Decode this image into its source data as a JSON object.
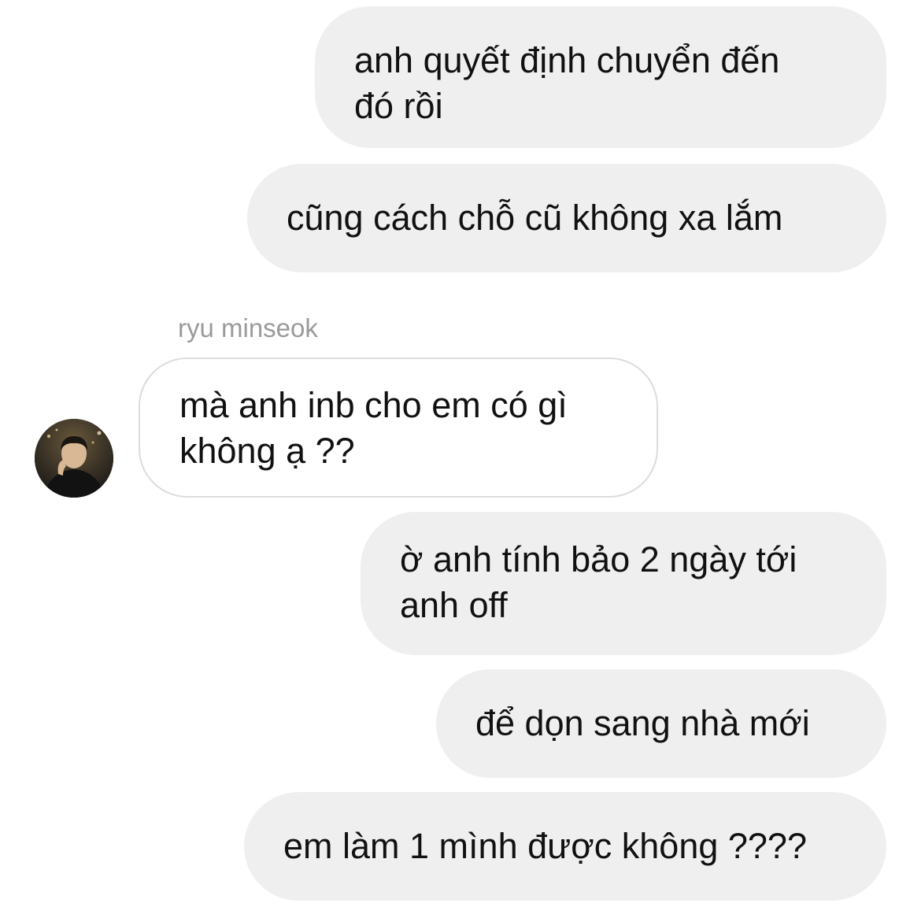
{
  "conversation": {
    "messages": [
      {
        "direction": "outgoing",
        "text": "anh quyết định chuyển đến\nđó rồi"
      },
      {
        "direction": "outgoing",
        "text": "cũng cách chỗ cũ không xa lắm"
      },
      {
        "direction": "incoming",
        "sender": "ryu minseok",
        "text": "mà anh inb cho em có gì\nkhông ạ ??"
      },
      {
        "direction": "outgoing",
        "text": "ờ anh tính bảo 2 ngày tới\nanh off"
      },
      {
        "direction": "outgoing",
        "text": "để dọn sang nhà mới"
      },
      {
        "direction": "outgoing",
        "text": "em làm 1 mình được không ????"
      }
    ]
  },
  "colors": {
    "outgoing_bubble": "#efefef",
    "incoming_bubble_border": "#dcdcdc",
    "sender_name": "#9a9a9a",
    "text": "#111111"
  },
  "icons": {
    "avatar": "user-avatar-photo"
  }
}
